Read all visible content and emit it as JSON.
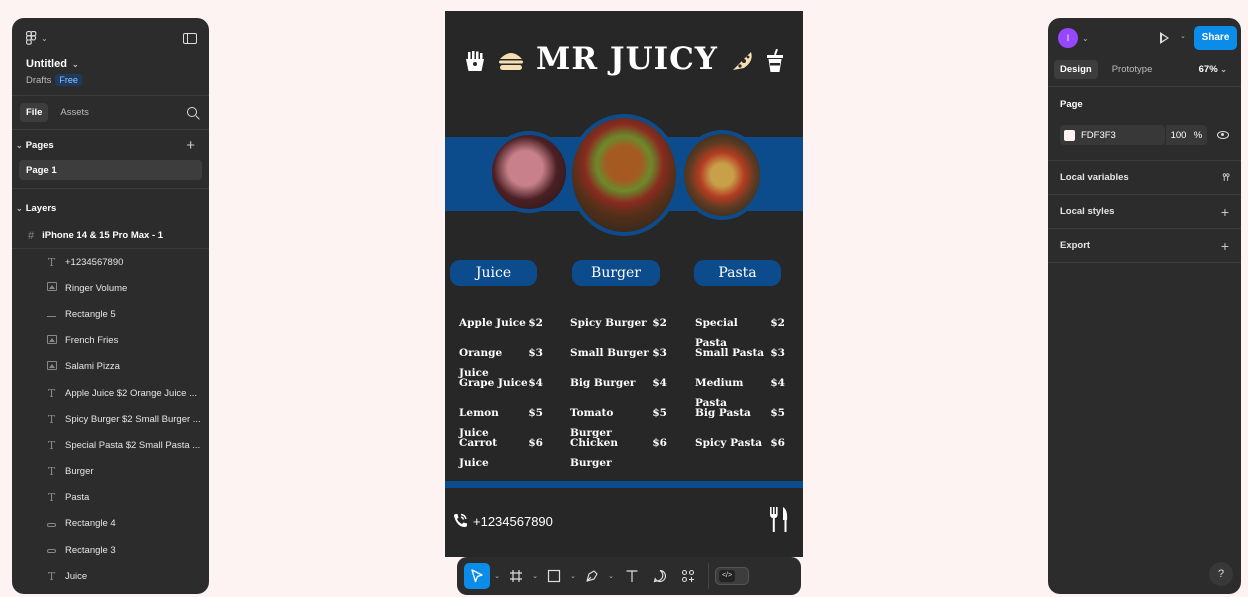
{
  "left_panel": {
    "file_name": "Untitled",
    "location": "Drafts",
    "plan_badge": "Free",
    "tabs": [
      "File",
      "Assets"
    ],
    "pages_heading": "Pages",
    "pages": [
      "Page 1"
    ],
    "layers_heading": "Layers",
    "frame_name": "iPhone 14 & 15 Pro Max - 1",
    "layers": [
      {
        "name": "+1234567890",
        "type": "text"
      },
      {
        "name": "Ringer Volume",
        "type": "image"
      },
      {
        "name": "Rectangle 5",
        "type": "line"
      },
      {
        "name": "French Fries",
        "type": "image"
      },
      {
        "name": "Salami Pizza",
        "type": "image"
      },
      {
        "name": "Apple Juice $2 Orange Juice ...",
        "type": "text"
      },
      {
        "name": "Spicy Burger $2 Small Burger ...",
        "type": "text"
      },
      {
        "name": "Special Pasta $2 Small Pasta ...",
        "type": "text"
      },
      {
        "name": "Burger",
        "type": "text"
      },
      {
        "name": "Pasta",
        "type": "text"
      },
      {
        "name": "Rectangle 4",
        "type": "rect"
      },
      {
        "name": "Rectangle 3",
        "type": "rect"
      },
      {
        "name": "Juice",
        "type": "text"
      }
    ]
  },
  "canvas": {
    "menu_title": "MR JUICY",
    "categories": [
      "Juice",
      "Burger",
      "Pasta"
    ],
    "juice_items": [
      {
        "name": "Apple Juice",
        "price": "$2"
      },
      {
        "name": "Orange Juice",
        "price": "$3"
      },
      {
        "name": "Grape Juice",
        "price": "$4"
      },
      {
        "name": "Lemon Juice",
        "price": "$5"
      },
      {
        "name": "Carrot Juice",
        "price": "$6"
      }
    ],
    "burger_items": [
      {
        "name": "Spicy Burger",
        "price": "$2"
      },
      {
        "name": "Small Burger",
        "price": "$3"
      },
      {
        "name": "Big Burger",
        "price": "$4"
      },
      {
        "name": "Tomato Burger",
        "price": "$5"
      },
      {
        "name": "Chicken Burger",
        "price": "$6"
      }
    ],
    "pasta_items": [
      {
        "name": "Special Pasta",
        "price": "$2"
      },
      {
        "name": "Small Pasta",
        "price": "$3"
      },
      {
        "name": "Medium Pasta",
        "price": "$4"
      },
      {
        "name": "Big Pasta",
        "price": "$5"
      },
      {
        "name": "Spicy Pasta",
        "price": "$6"
      }
    ],
    "phone": "+1234567890",
    "colors": {
      "frame_bg": "#272727",
      "accent_blue": "#0d4c8c",
      "page_bg": "#FDF3F3"
    }
  },
  "toolbar": {
    "tools": [
      "move-tool",
      "frame-tool",
      "shape-tool",
      "pen-tool",
      "text-tool",
      "comment-tool",
      "actions-tool"
    ],
    "dev_mode_symbol": "</>"
  },
  "right_panel": {
    "avatar_initial": "I",
    "share_label": "Share",
    "tabs": [
      "Design",
      "Prototype"
    ],
    "zoom": "67%",
    "page_heading": "Page",
    "bg_color_hex": "FDF3F3",
    "bg_opacity": "100",
    "opacity_unit": "%",
    "sections": [
      "Local variables",
      "Local styles",
      "Export"
    ],
    "help_label": "?"
  }
}
